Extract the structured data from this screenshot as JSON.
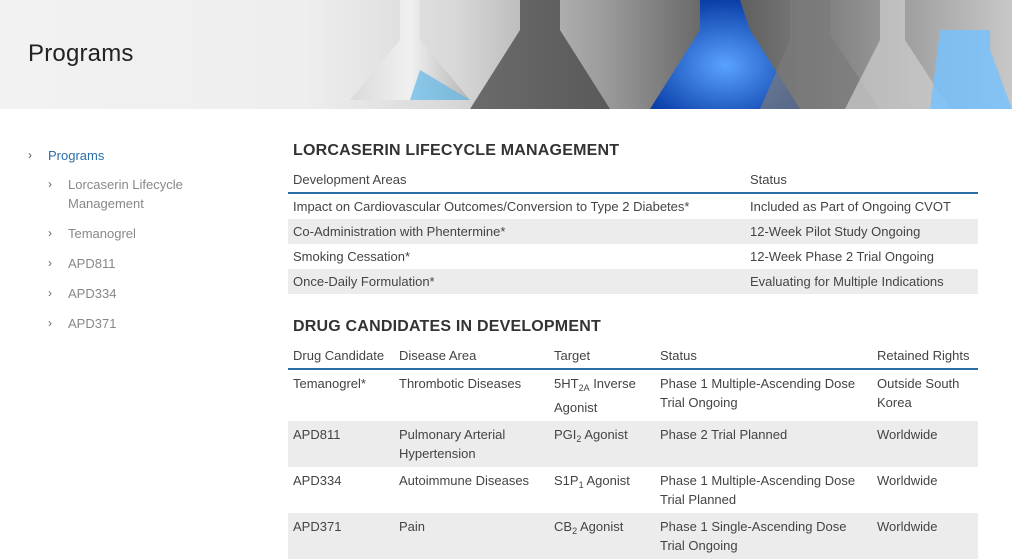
{
  "header": {
    "title": "Programs"
  },
  "sidebar": {
    "root": "Programs",
    "items": [
      {
        "label": "Lorcaserin Lifecycle Management"
      },
      {
        "label": "Temanogrel"
      },
      {
        "label": "APD811"
      },
      {
        "label": "APD334"
      },
      {
        "label": "APD371"
      }
    ]
  },
  "lifecycle": {
    "title": "LORCASERIN LIFECYCLE MANAGEMENT",
    "headers": {
      "area": "Development Areas",
      "status": "Status"
    },
    "rows": [
      {
        "area": "Impact on Cardiovascular Outcomes/Conversion to Type 2 Diabetes*",
        "status": "Included as Part of Ongoing CVOT"
      },
      {
        "area": "Co-Administration with Phentermine*",
        "status": "12-Week Pilot Study Ongoing"
      },
      {
        "area": "Smoking Cessation*",
        "status": "12-Week Phase 2 Trial Ongoing"
      },
      {
        "area": "Once-Daily Formulation*",
        "status": "Evaluating for Multiple Indications"
      }
    ]
  },
  "candidates": {
    "title": "DRUG CANDIDATES IN DEVELOPMENT",
    "headers": {
      "drug": "Drug Candidate",
      "disease": "Disease Area",
      "target": "Target",
      "status": "Status",
      "rights": "Retained Rights"
    },
    "rows": [
      {
        "drug": "Temanogrel*",
        "disease": "Thrombotic Diseases",
        "target_base": "5HT",
        "target_sub": "2A",
        "target_rest": " Inverse Agonist",
        "status": "Phase 1 Multiple-Ascending Dose Trial Ongoing",
        "rights": "Outside South Korea"
      },
      {
        "drug": "APD811",
        "disease": "Pulmonary Arterial Hypertension",
        "target_base": "PGI",
        "target_sub": "2",
        "target_rest": " Agonist",
        "status": "Phase 2 Trial Planned",
        "rights": "Worldwide"
      },
      {
        "drug": "APD334",
        "disease": "Autoimmune Diseases",
        "target_base": "S1P",
        "target_sub": "1",
        "target_rest": " Agonist",
        "status": "Phase 1 Multiple-Ascending Dose Trial Planned",
        "rights": "Worldwide"
      },
      {
        "drug": "APD371",
        "disease": "Pain",
        "target_base": "CB",
        "target_sub": "2",
        "target_rest": " Agonist",
        "status": "Phase 1 Single-Ascending Dose Trial Ongoing",
        "rights": "Worldwide"
      }
    ]
  },
  "icons": {
    "sidebar_chevron": "chevron-right-icon"
  },
  "colors": {
    "accent": "#2a6ea6",
    "row_alt": "#ececec",
    "text": "#444444"
  }
}
